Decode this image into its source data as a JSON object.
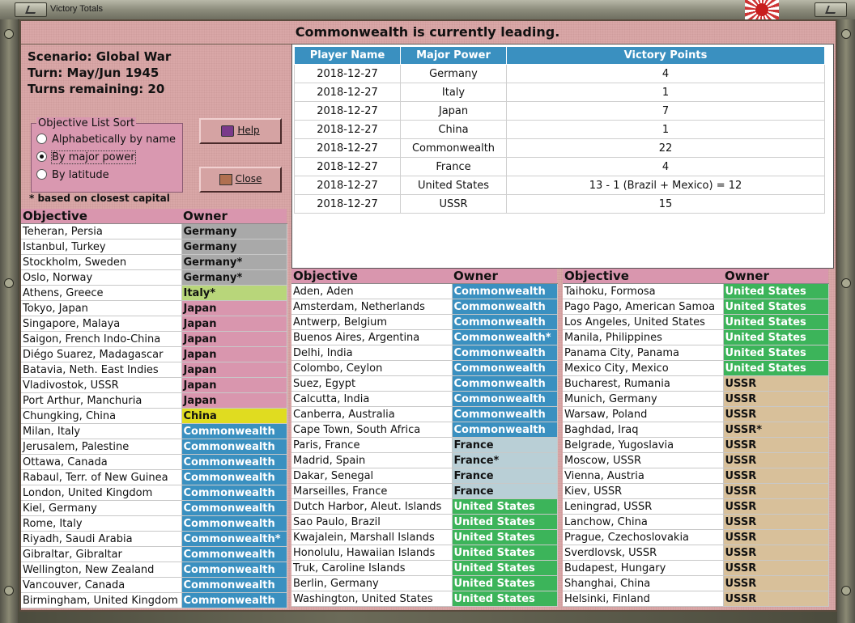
{
  "window": {
    "title": "Victory Totals"
  },
  "headline": "Commonwealth is currently leading.",
  "scenario": {
    "name_line": "Scenario: Global War",
    "turn_line": "Turn: May/Jun 1945",
    "remaining_line": "Turns remaining: 20"
  },
  "sort": {
    "legend": "Objective List Sort",
    "options": [
      "Alphabetically by name",
      "By major power",
      "By latitude"
    ],
    "selected_index": 1
  },
  "note": "* based on closest capital",
  "buttons": {
    "help": "Help",
    "close": "Close"
  },
  "owner_colors": {
    "Germany": "#a9a9a9",
    "Italy": "#b8d67a",
    "Japan": "#d996ae",
    "China": "#e0dc20",
    "Commonwealth": "#3a90c0",
    "France": "#b9cfd6",
    "United States": "#3cb45a",
    "USSR": "#d8c09a"
  },
  "owner_text_colors": {
    "Germany": "#111111",
    "Italy": "#111111",
    "Japan": "#111111",
    "China": "#111111",
    "Commonwealth": "#ffffff",
    "France": "#111111",
    "United States": "#ffffff",
    "USSR": "#111111"
  },
  "vp_table": {
    "headers": [
      "Player Name",
      "Major Power",
      "Victory Points"
    ],
    "rows": [
      [
        "2018-12-27",
        "Germany",
        "4"
      ],
      [
        "2018-12-27",
        "Italy",
        "1"
      ],
      [
        "2018-12-27",
        "Japan",
        "7"
      ],
      [
        "2018-12-27",
        "China",
        "1"
      ],
      [
        "2018-12-27",
        "Commonwealth",
        "22"
      ],
      [
        "2018-12-27",
        "France",
        "4"
      ],
      [
        "2018-12-27",
        "United States",
        "13 - 1 (Brazil + Mexico) = 12"
      ],
      [
        "2018-12-27",
        "USSR",
        "15"
      ]
    ]
  },
  "objective_headers": {
    "objective": "Objective",
    "owner": "Owner"
  },
  "objectives_left": [
    [
      "Teheran, Persia",
      "Germany",
      "Germany"
    ],
    [
      "Istanbul, Turkey",
      "Germany",
      "Germany"
    ],
    [
      "Stockholm, Sweden",
      "Germany*",
      "Germany"
    ],
    [
      "Oslo, Norway",
      "Germany*",
      "Germany"
    ],
    [
      "Athens, Greece",
      "Italy*",
      "Italy"
    ],
    [
      "Tokyo, Japan",
      "Japan",
      "Japan"
    ],
    [
      "Singapore, Malaya",
      "Japan",
      "Japan"
    ],
    [
      "Saigon, French Indo-China",
      "Japan",
      "Japan"
    ],
    [
      "Diégo Suarez, Madagascar",
      "Japan",
      "Japan"
    ],
    [
      "Batavia, Neth. East Indies",
      "Japan",
      "Japan"
    ],
    [
      "Vladivostok, USSR",
      "Japan",
      "Japan"
    ],
    [
      "Port Arthur, Manchuria",
      "Japan",
      "Japan"
    ],
    [
      "Chungking, China",
      "China",
      "China"
    ],
    [
      "Milan, Italy",
      "Commonwealth",
      "Commonwealth"
    ],
    [
      "Jerusalem, Palestine",
      "Commonwealth",
      "Commonwealth"
    ],
    [
      "Ottawa, Canada",
      "Commonwealth",
      "Commonwealth"
    ],
    [
      "Rabaul, Terr. of New Guinea",
      "Commonwealth",
      "Commonwealth"
    ],
    [
      "London, United Kingdom",
      "Commonwealth",
      "Commonwealth"
    ],
    [
      "Kiel, Germany",
      "Commonwealth",
      "Commonwealth"
    ],
    [
      "Rome, Italy",
      "Commonwealth",
      "Commonwealth"
    ],
    [
      "Riyadh, Saudi Arabia",
      "Commonwealth*",
      "Commonwealth"
    ],
    [
      "Gibraltar, Gibraltar",
      "Commonwealth",
      "Commonwealth"
    ],
    [
      "Wellington, New Zealand",
      "Commonwealth",
      "Commonwealth"
    ],
    [
      "Vancouver, Canada",
      "Commonwealth",
      "Commonwealth"
    ],
    [
      "Birmingham, United Kingdom",
      "Commonwealth",
      "Commonwealth"
    ]
  ],
  "objectives_mid": [
    [
      "Aden, Aden",
      "Commonwealth",
      "Commonwealth"
    ],
    [
      "Amsterdam, Netherlands",
      "Commonwealth",
      "Commonwealth"
    ],
    [
      "Antwerp, Belgium",
      "Commonwealth",
      "Commonwealth"
    ],
    [
      "Buenos Aires, Argentina",
      "Commonwealth*",
      "Commonwealth"
    ],
    [
      "Delhi, India",
      "Commonwealth",
      "Commonwealth"
    ],
    [
      "Colombo, Ceylon",
      "Commonwealth",
      "Commonwealth"
    ],
    [
      "Suez, Egypt",
      "Commonwealth",
      "Commonwealth"
    ],
    [
      "Calcutta, India",
      "Commonwealth",
      "Commonwealth"
    ],
    [
      "Canberra, Australia",
      "Commonwealth",
      "Commonwealth"
    ],
    [
      "Cape Town, South Africa",
      "Commonwealth",
      "Commonwealth"
    ],
    [
      "Paris, France",
      "France",
      "France"
    ],
    [
      "Madrid, Spain",
      "France*",
      "France"
    ],
    [
      "Dakar, Senegal",
      "France",
      "France"
    ],
    [
      "Marseilles, France",
      "France",
      "France"
    ],
    [
      "Dutch Harbor, Aleut. Islands",
      "United States",
      "United States"
    ],
    [
      "Sao Paulo, Brazil",
      "United States",
      "United States"
    ],
    [
      "Kwajalein, Marshall Islands",
      "United States",
      "United States"
    ],
    [
      "Honolulu, Hawaiian Islands",
      "United States",
      "United States"
    ],
    [
      "Truk, Caroline Islands",
      "United States",
      "United States"
    ],
    [
      "Berlin, Germany",
      "United States",
      "United States"
    ],
    [
      "Washington, United States",
      "United States",
      "United States"
    ]
  ],
  "objectives_right": [
    [
      "Taihoku, Formosa",
      "United States",
      "United States"
    ],
    [
      "Pago Pago, American Samoa",
      "United States",
      "United States"
    ],
    [
      "Los Angeles, United States",
      "United States",
      "United States"
    ],
    [
      "Manila, Philippines",
      "United States",
      "United States"
    ],
    [
      "Panama City, Panama",
      "United States",
      "United States"
    ],
    [
      "Mexico City, Mexico",
      "United States",
      "United States"
    ],
    [
      "Bucharest, Rumania",
      "USSR",
      "USSR"
    ],
    [
      "Munich, Germany",
      "USSR",
      "USSR"
    ],
    [
      "Warsaw, Poland",
      "USSR",
      "USSR"
    ],
    [
      "Baghdad, Iraq",
      "USSR*",
      "USSR"
    ],
    [
      "Belgrade, Yugoslavia",
      "USSR",
      "USSR"
    ],
    [
      "Moscow, USSR",
      "USSR",
      "USSR"
    ],
    [
      "Vienna, Austria",
      "USSR",
      "USSR"
    ],
    [
      "Kiev, USSR",
      "USSR",
      "USSR"
    ],
    [
      "Leningrad, USSR",
      "USSR",
      "USSR"
    ],
    [
      "Lanchow, China",
      "USSR",
      "USSR"
    ],
    [
      "Prague, Czechoslovakia",
      "USSR",
      "USSR"
    ],
    [
      "Sverdlovsk, USSR",
      "USSR",
      "USSR"
    ],
    [
      "Budapest, Hungary",
      "USSR",
      "USSR"
    ],
    [
      "Shanghai, China",
      "USSR",
      "USSR"
    ],
    [
      "Helsinki, Finland",
      "USSR",
      "USSR"
    ]
  ]
}
